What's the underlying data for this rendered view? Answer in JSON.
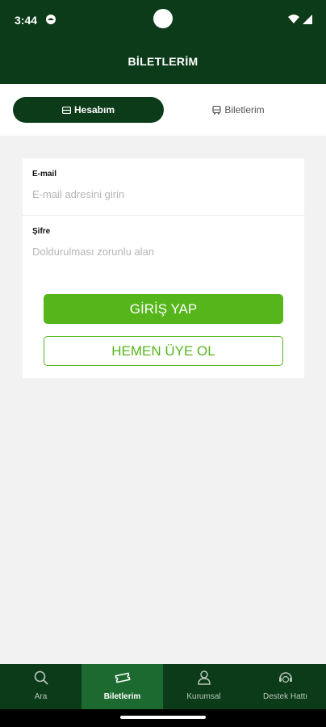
{
  "status": {
    "time": "3:44"
  },
  "header": {
    "title": "BİLETLERİM"
  },
  "tabs": [
    {
      "label": "Hesabım",
      "icon": "ticket-icon",
      "active": true
    },
    {
      "label": "Biletlerim",
      "icon": "bus-icon",
      "active": false
    }
  ],
  "form": {
    "email": {
      "label": "E-mail",
      "placeholder": "E-mail adresini girin",
      "value": ""
    },
    "password": {
      "label": "Şifre",
      "placeholder": "Doldurulması zorunlu alan",
      "value": ""
    },
    "login_label": "GİRİŞ YAP",
    "signup_label": "HEMEN ÜYE OL"
  },
  "bottom_nav": [
    {
      "label": "Ara",
      "icon": "search-icon",
      "active": false
    },
    {
      "label": "Biletlerim",
      "icon": "ticket-icon",
      "active": true
    },
    {
      "label": "Kurumsal",
      "icon": "person-icon",
      "active": false
    },
    {
      "label": "Destek Hattı",
      "icon": "support-icon",
      "active": false
    }
  ],
  "colors": {
    "primary_dark": "#0b3b18",
    "accent_green": "#56b51b",
    "nav_active": "#1d6a30",
    "background": "#f2f2f2"
  }
}
